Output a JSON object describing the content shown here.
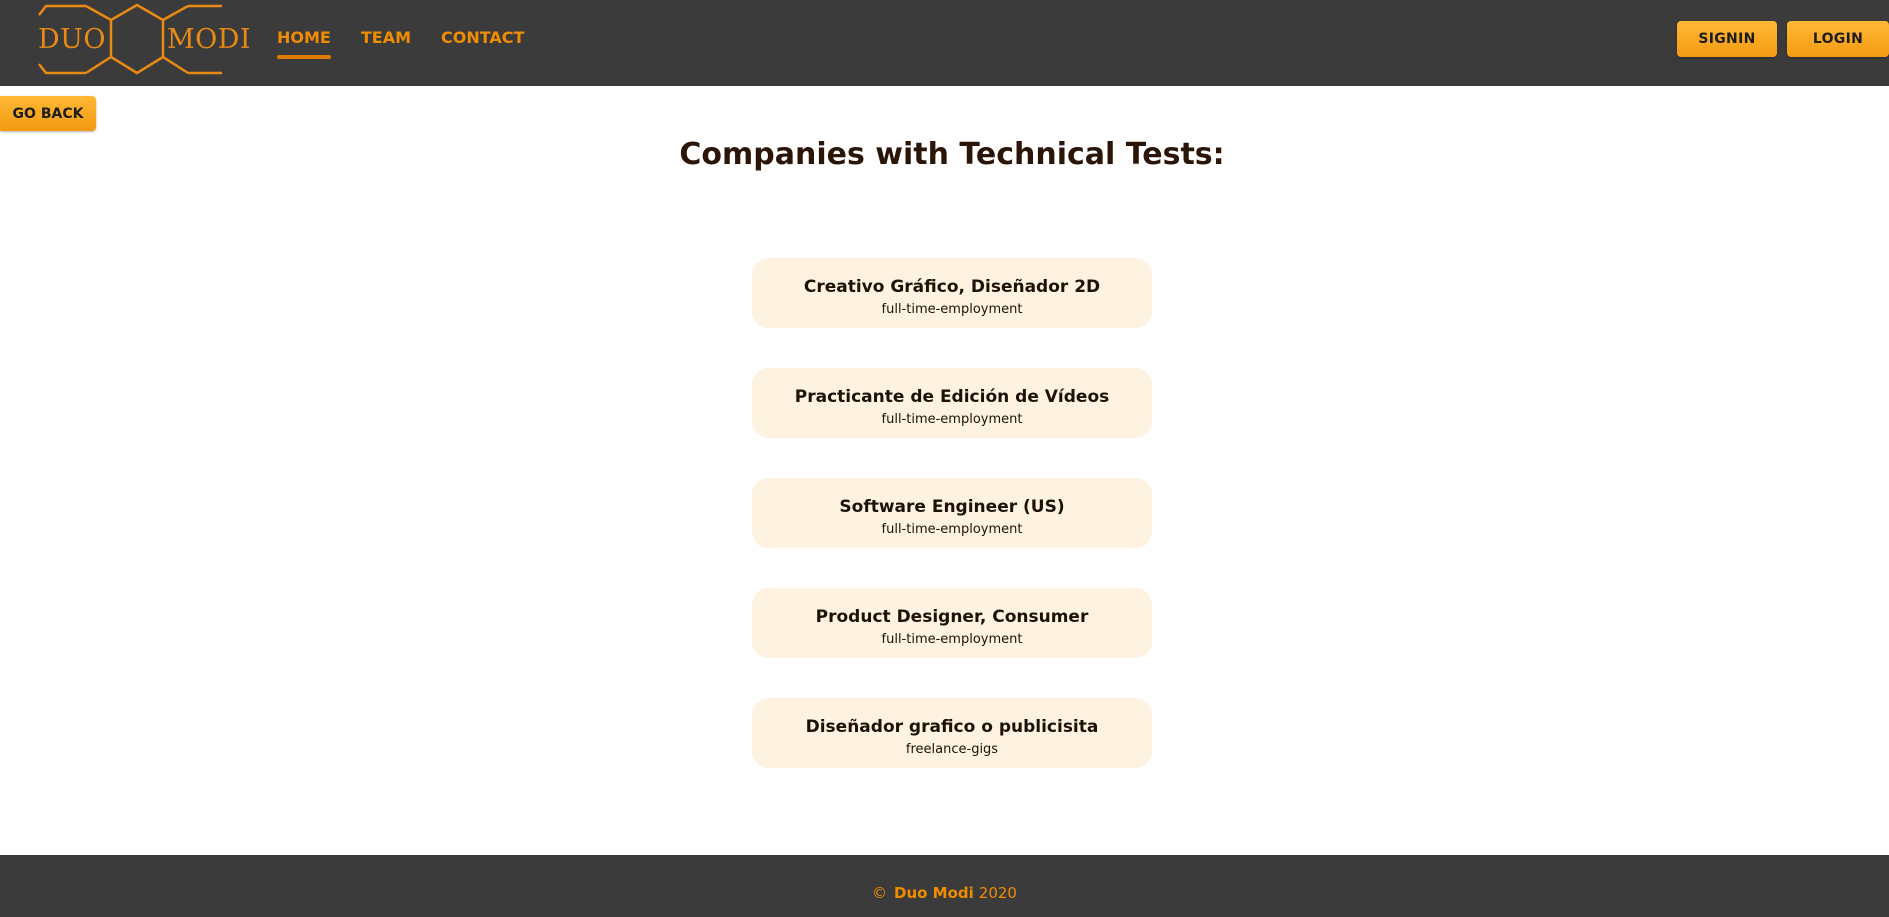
{
  "header": {
    "logo": {
      "left_text": "DUO",
      "right_text": "MODI",
      "icon": "hexagon-logo-icon"
    },
    "nav": [
      {
        "label": "HOME",
        "active": true
      },
      {
        "label": "TEAM",
        "active": false
      },
      {
        "label": "CONTACT",
        "active": false
      }
    ],
    "signin_label": "SIGNIN",
    "login_label": "LOGIN"
  },
  "main": {
    "go_back_label": "GO BACK",
    "title": "Companies with Technical Tests:",
    "jobs": [
      {
        "title": "Creativo Gráfico, Diseñador 2D",
        "type": "full-time-employment"
      },
      {
        "title": "Practicante de Edición de Vídeos",
        "type": "full-time-employment"
      },
      {
        "title": "Software Engineer (US)",
        "type": "full-time-employment"
      },
      {
        "title": "Product Designer, Consumer",
        "type": "full-time-employment"
      },
      {
        "title": "Diseñador grafico o publicisita",
        "type": "freelance-gigs"
      }
    ]
  },
  "footer": {
    "copyright_symbol": "©",
    "brand": "Duo Modi",
    "year": "2020"
  },
  "colors": {
    "header_bg": "#3b3b3b",
    "accent": "#f08c00",
    "button_gradient_top": "#ffb834",
    "button_gradient_bottom": "#f39a12",
    "card_bg": "#fef3e1",
    "title_text": "#2b1508"
  }
}
